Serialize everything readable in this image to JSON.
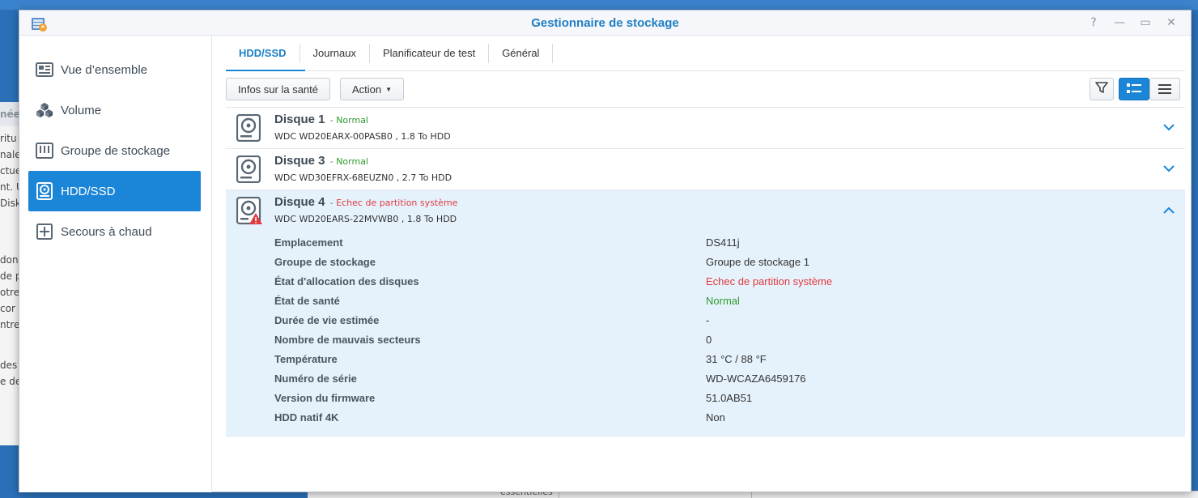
{
  "window": {
    "title": "Gestionnaire de stockage"
  },
  "window_controls": {
    "help": "?",
    "minimize": "—",
    "maximize": "▭",
    "close": "✕"
  },
  "sidebar": {
    "items": [
      {
        "label": "Vue d’ensemble",
        "icon": "overview-icon",
        "active": false
      },
      {
        "label": "Volume",
        "icon": "volume-cubes-icon",
        "active": false
      },
      {
        "label": "Groupe de stockage",
        "icon": "storage-pool-icon",
        "active": false
      },
      {
        "label": "HDD/SSD",
        "icon": "hdd-icon",
        "active": true
      },
      {
        "label": "Secours à chaud",
        "icon": "hot-spare-icon",
        "active": false
      }
    ]
  },
  "tabs": [
    {
      "label": "HDD/SSD",
      "active": true
    },
    {
      "label": "Journaux",
      "active": false
    },
    {
      "label": "Planificateur de test",
      "active": false
    },
    {
      "label": "Général",
      "active": false
    }
  ],
  "toolbar": {
    "health_info_label": "Infos sur la santé",
    "action_label": "Action",
    "filter_icon": "filter-icon",
    "view_list_icon": "detail-list-view-icon",
    "view_compact_icon": "compact-list-view-icon"
  },
  "disks": [
    {
      "name": "Disque 1",
      "separator": "-",
      "status": "Normal",
      "status_kind": "normal",
      "subtitle": "WDC WD20EARX-00PASB0 , 1.8 To HDD",
      "expanded": false
    },
    {
      "name": "Disque 3",
      "separator": "-",
      "status": "Normal",
      "status_kind": "normal",
      "subtitle": "WDC WD30EFRX-68EUZN0 , 2.7 To HDD",
      "expanded": false
    },
    {
      "name": "Disque 4",
      "separator": "-",
      "status": "Echec de partition système",
      "status_kind": "error",
      "subtitle": "WDC WD20EARS-22MVWB0 , 1.8 To HDD",
      "expanded": true,
      "details": [
        {
          "label": "Emplacement",
          "value": "DS411j",
          "kind": ""
        },
        {
          "label": "Groupe de stockage",
          "value": "Groupe de stockage 1",
          "kind": ""
        },
        {
          "label": "État d'allocation des disques",
          "value": "Echec de partition système",
          "kind": "error"
        },
        {
          "label": "État de santé",
          "value": "Normal",
          "kind": "ok"
        },
        {
          "label": "Durée de vie estimée",
          "value": "-",
          "kind": ""
        },
        {
          "label": "Nombre de mauvais secteurs",
          "value": "0",
          "kind": ""
        },
        {
          "label": "Température",
          "value": "31 °C / 88 °F",
          "kind": ""
        },
        {
          "label": "Numéro de série",
          "value": "WD-WCAZA6459176",
          "kind": ""
        },
        {
          "label": "Version du firmware",
          "value": "51.0AB51",
          "kind": ""
        },
        {
          "label": "HDD natif 4K",
          "value": "Non",
          "kind": ""
        }
      ]
    }
  ],
  "background": {
    "left_fragments": [
      "née",
      "ritu",
      "nale",
      "ctue",
      "nt. U",
      "DiskS",
      "donn",
      "de p",
      "otre",
      "cor",
      "ntrez",
      "des",
      "e de"
    ],
    "bottom_fragment": "essentielles"
  },
  "colors": {
    "accent": "#1b86d8",
    "title": "#1f7fc4",
    "normal": "#2e9a2e",
    "error": "#e0393e",
    "expanded_row": "#e6f2fb"
  }
}
